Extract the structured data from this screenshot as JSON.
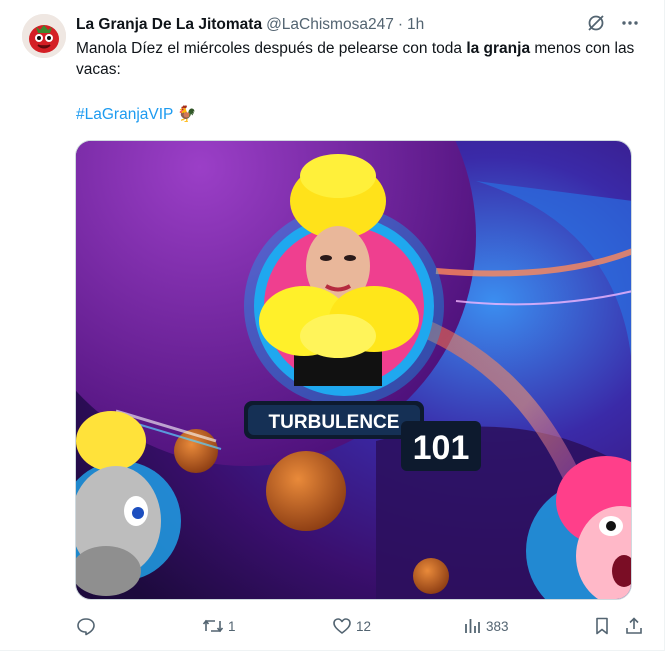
{
  "tweet": {
    "author_name": "La Granja De La Jitomata",
    "handle": "@LaChismosa247",
    "separator": "·",
    "time": "1h",
    "text_part1": "Manola Díez el miércoles después de pelearse con toda ",
    "text_bold": "la granja",
    "text_part2": " menos con las vacas:",
    "hashtag": "#LaGranjaVIP",
    "emoji": "🐓"
  },
  "media": {
    "title_text": "TURBULENCE",
    "number_text": "101"
  },
  "actions": {
    "reply_count": "",
    "retweet_count": "1",
    "like_count": "12",
    "views_count": "383"
  },
  "colors": {
    "link": "#1d9bf0",
    "muted": "#536471",
    "text": "#0f1419"
  }
}
